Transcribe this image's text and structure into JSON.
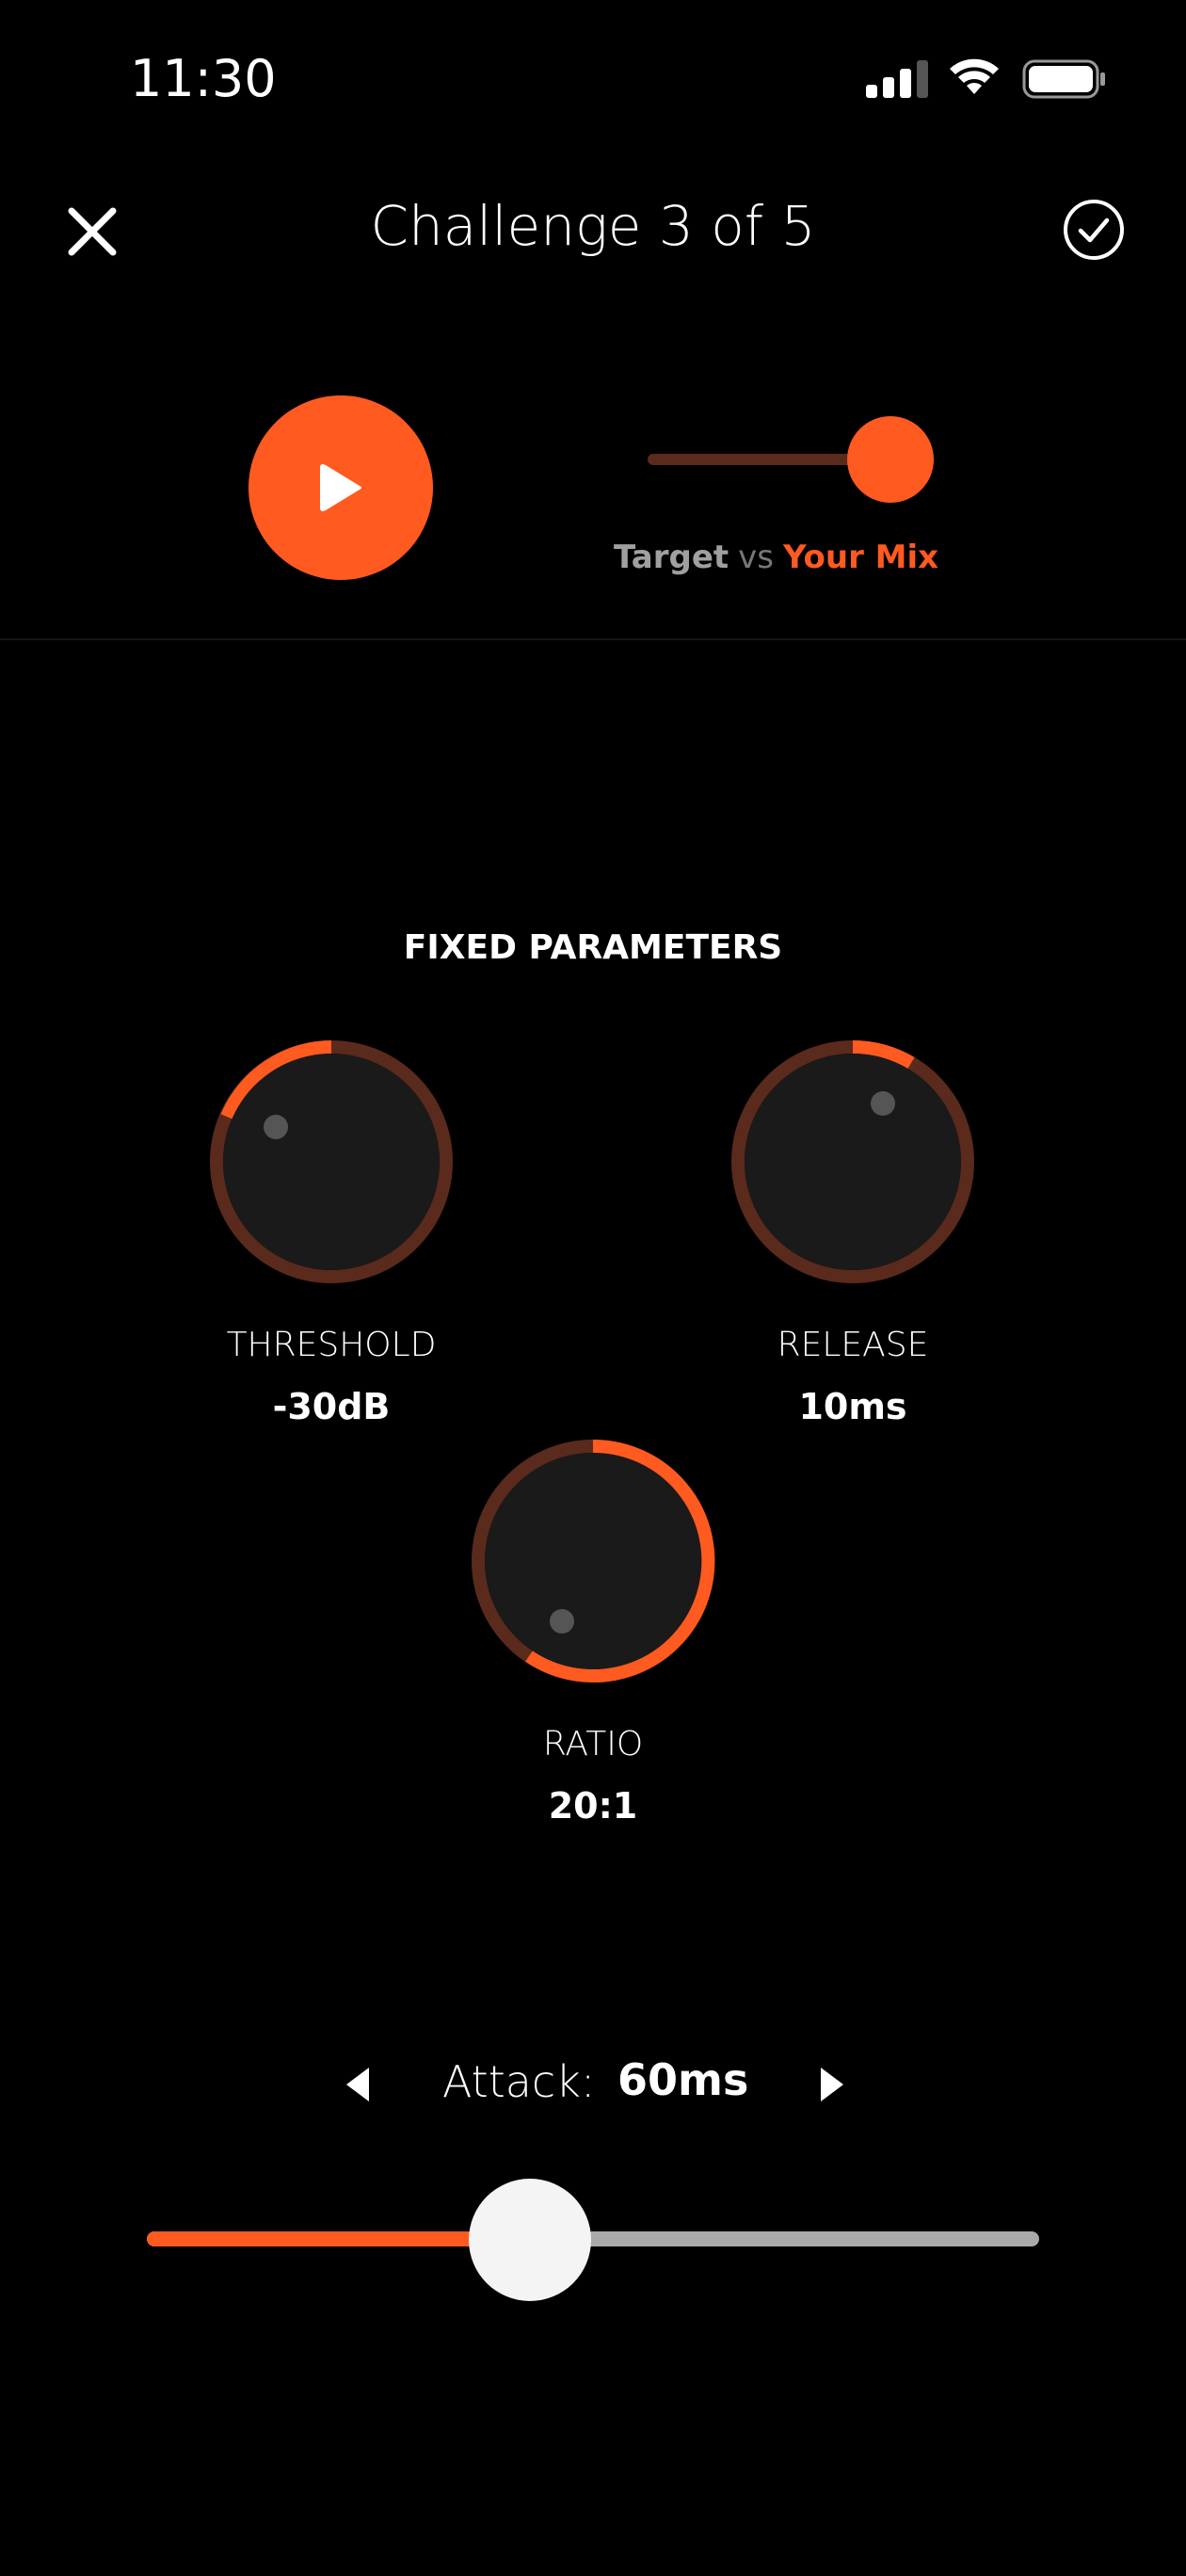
{
  "status_bar": {
    "time": "11:30"
  },
  "header": {
    "title": "Challenge 3 of 5"
  },
  "ab_toggle": {
    "target_label": "Target",
    "vs_label": "vs",
    "mix_label": "Your Mix",
    "position": 1.0
  },
  "section": {
    "title": "FIXED PARAMETERS"
  },
  "knobs": [
    {
      "label": "THRESHOLD",
      "value": "-30dB",
      "level": 0.15
    },
    {
      "label": "RELEASE",
      "value": "10ms",
      "level": 0.05
    },
    {
      "label": "RATIO",
      "value": "20:1",
      "level": 0.65
    }
  ],
  "attack": {
    "label": "Attack:",
    "value": "60ms",
    "level": 0.4
  },
  "colors": {
    "accent": "#ff5a1f",
    "track_dark": "#5a2a1c",
    "knob_body": "#1a1a1a"
  },
  "icons": [
    "close-icon",
    "checkmark-circle-icon",
    "play-icon",
    "chevron-left-icon",
    "chevron-right-icon"
  ]
}
